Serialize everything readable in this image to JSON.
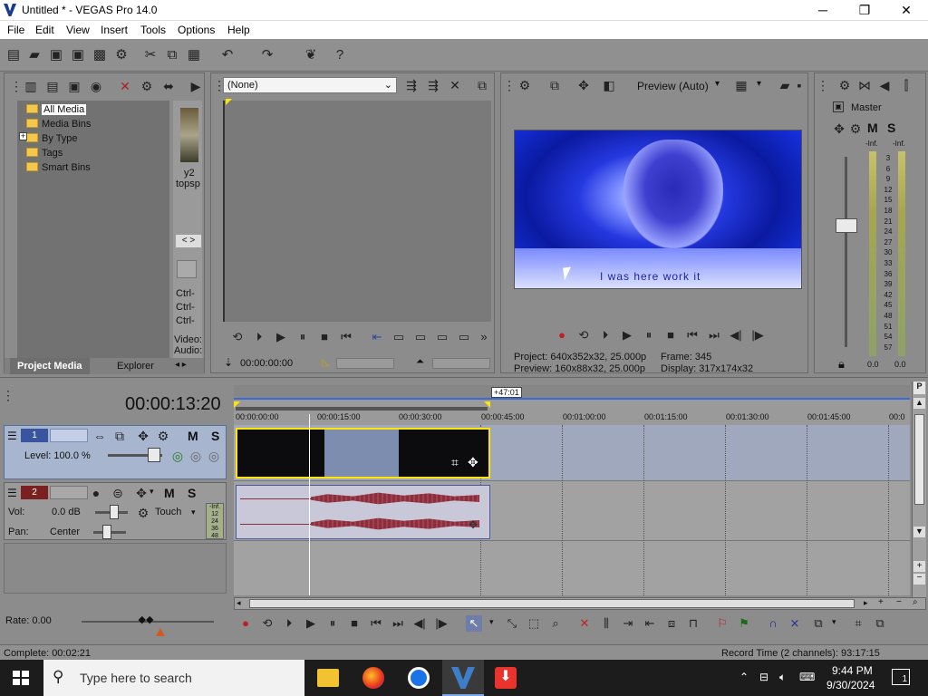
{
  "window": {
    "title": "Untitled * - VEGAS Pro 14.0",
    "minimize": "─",
    "maximize": "❐",
    "close": "✕"
  },
  "menu": [
    "File",
    "Edit",
    "View",
    "Insert",
    "Tools",
    "Options",
    "Help"
  ],
  "toolbar_icons": [
    "new-icon",
    "open-icon",
    "save-icon",
    "save-as-icon",
    "render-icon",
    "properties-icon",
    "cut-icon",
    "copy-icon",
    "paste-icon",
    "undo-icon",
    "redo-icon",
    "enable-snapping-icon",
    "help-icon"
  ],
  "project_media": {
    "tree": [
      "All Media",
      "Media Bins",
      "By Type",
      "Tags",
      "Smart Bins"
    ],
    "expand": "+",
    "thumb_caption_1": "y2",
    "thumb_caption_2": "topsp",
    "ctrl_lines": [
      "Ctrl-",
      "Ctrl-",
      "Ctrl-"
    ],
    "meta_lines": [
      "Video:",
      "Audio:"
    ],
    "tabs": [
      "Project Media",
      "Explorer"
    ],
    "nav": [
      "<",
      ">"
    ]
  },
  "trimmer": {
    "select": "(None)",
    "timecode": "00:00:00:00"
  },
  "preview": {
    "mode": "Preview (Auto)",
    "subtitle": "I was here work it",
    "project_label": "Project:",
    "project_value": "640x352x32, 25.000p",
    "frame_label": "Frame:",
    "frame_value": "345",
    "preview_label": "Preview:",
    "preview_value": "160x88x32, 25.000p",
    "display_label": "Display:",
    "display_value": "317x174x32"
  },
  "master": {
    "label": "Master",
    "m": "M",
    "s": "S",
    "inf": "-Inf.",
    "inf2": "-Inf.",
    "scale": [
      "3",
      "6",
      "9",
      "12",
      "15",
      "18",
      "21",
      "24",
      "27",
      "30",
      "33",
      "36",
      "39",
      "42",
      "45",
      "48",
      "51",
      "54",
      "57"
    ],
    "left_value": "0.0",
    "right_value": "0.0"
  },
  "timeline": {
    "cursor_time": "00:00:13:20",
    "marker": "+47:01",
    "ruler": [
      "00:00:00:00",
      "00:00:15:00",
      "00:00:30:00",
      "00:00:45:00",
      "00:01:00:00",
      "00:01:15:00",
      "00:01:30:00",
      "00:01:45:00",
      "00:0"
    ],
    "video_track": {
      "number": "1",
      "level": "Level: 100.0 %",
      "m": "M",
      "s": "S"
    },
    "audio_track": {
      "number": "2",
      "vol_label": "Vol:",
      "vol": "0.0 dB",
      "pan_label": "Pan:",
      "pan": "Center",
      "touch": "Touch",
      "m": "M",
      "s": "S",
      "meter": [
        "-Inf.",
        "12",
        "24",
        "36",
        "48"
      ]
    },
    "rate": "Rate: 0.00"
  },
  "status": {
    "complete": "Complete: 00:02:21",
    "record": "Record Time (2 channels): 93:17:15"
  },
  "taskbar": {
    "search": "Type here to search",
    "time": "9:44 PM",
    "date": "9/30/2024",
    "notif": "1"
  }
}
